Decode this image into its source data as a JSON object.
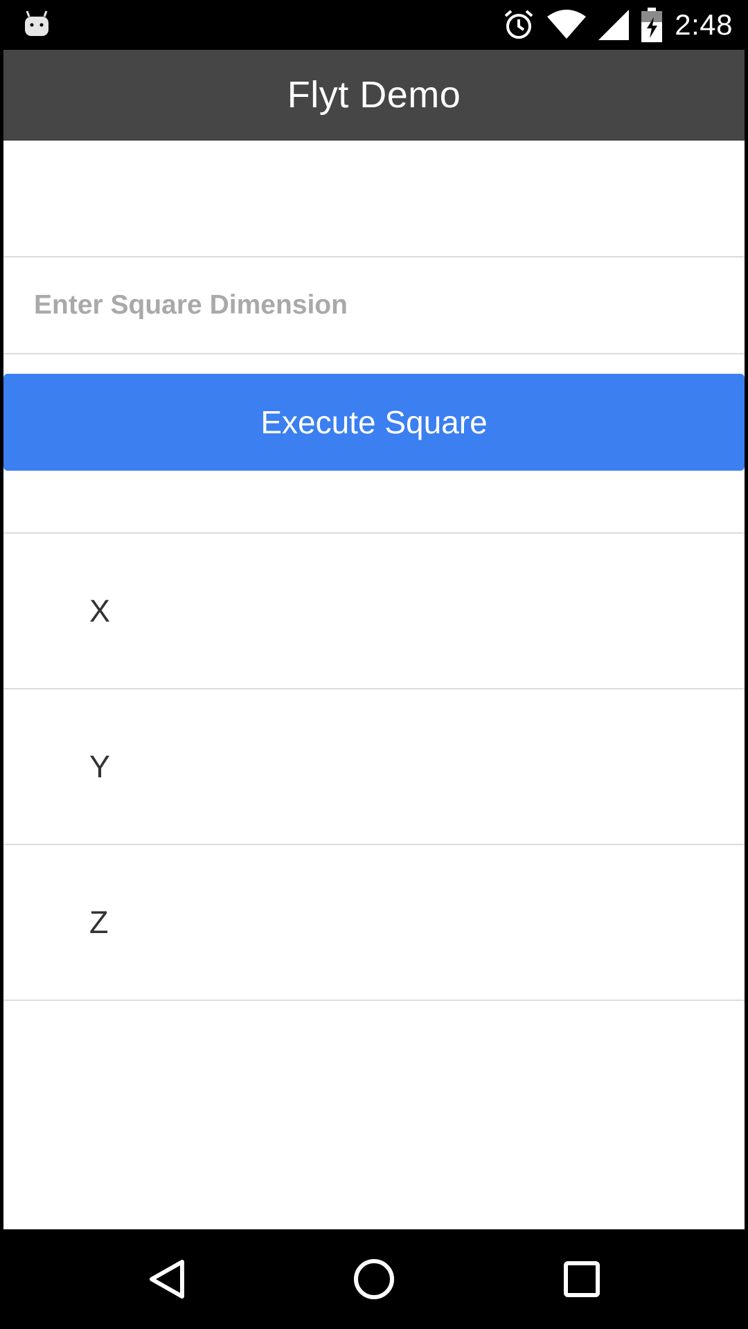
{
  "status_bar": {
    "time": "2:48",
    "icons": [
      "android-debug-icon",
      "alarm-icon",
      "wifi-icon",
      "signal-icon",
      "battery-charging-icon"
    ]
  },
  "app_bar": {
    "title": "Flyt Demo"
  },
  "square_form": {
    "dimension_value": "",
    "dimension_placeholder": "Enter Square Dimension",
    "execute_label": "Execute Square"
  },
  "axes": [
    {
      "label": "X"
    },
    {
      "label": "Y"
    },
    {
      "label": "Z"
    }
  ],
  "nav_bar": {
    "icons": [
      "back-icon",
      "home-icon",
      "recents-icon"
    ]
  },
  "colors": {
    "app_bar": "#464646",
    "accent_button": "#3b7ff0",
    "placeholder": "#a9a9a9",
    "divider": "#dcdcdc"
  }
}
